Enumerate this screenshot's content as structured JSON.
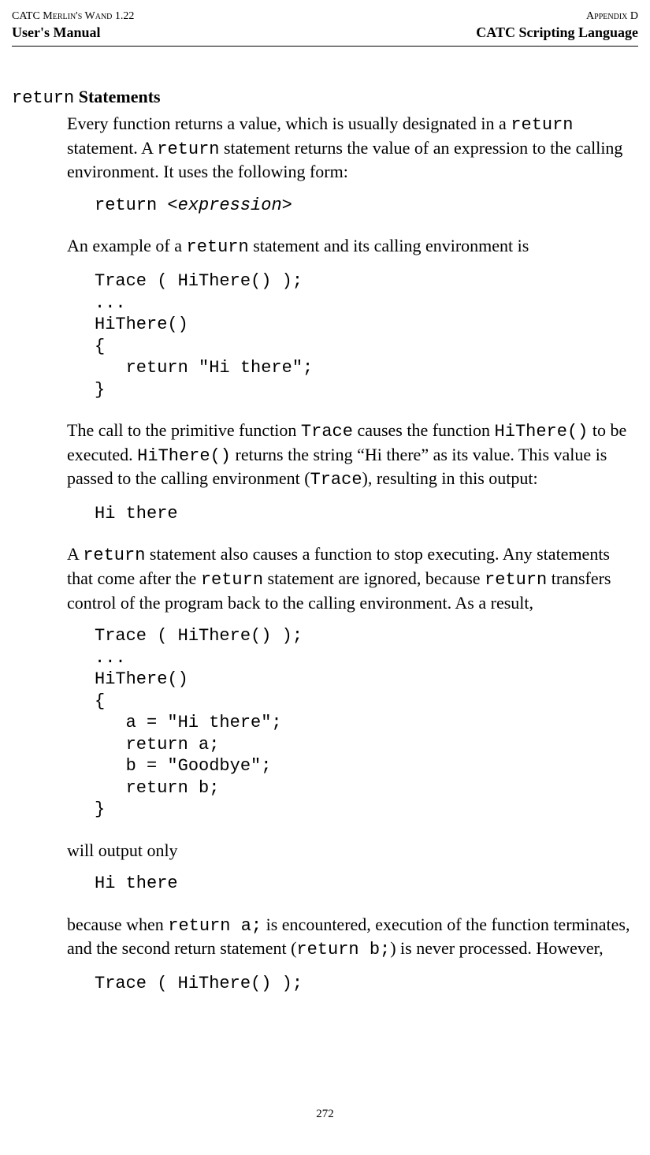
{
  "header": {
    "topLeft": "CATC Merlin's Wand 1.22",
    "topRight": "Appendix D",
    "bottomLeft": "User's Manual",
    "bottomRight": "CATC Scripting Language"
  },
  "section": {
    "titleCode": "return",
    "titleBold": " Statements"
  },
  "paragraphs": {
    "p1_part1": "Every function returns a value, which is usually designated in a ",
    "p1_code1": "return",
    "p1_part2": " statement. A ",
    "p1_code2": "return",
    "p1_part3": " statement returns the value of an expression to the calling environment. It uses the following form:",
    "p2_part1": "An example of a ",
    "p2_code1": "return",
    "p2_part2": " statement and its calling environment is",
    "p3_part1": "The call to the primitive function ",
    "p3_code1": "Trace",
    "p3_part2": " causes the function ",
    "p3_code2": "HiThere()",
    "p3_part3": " to be executed. ",
    "p3_code3": "HiThere()",
    "p3_part4": " returns the string “Hi there” as its value. This value is passed to the calling environment (",
    "p3_code4": "Trace",
    "p3_part5": "), resulting in this output:",
    "p4_part1": "A ",
    "p4_code1": "return",
    "p4_part2": " statement also causes a function to stop executing. Any statements that come after the ",
    "p4_code2": "return",
    "p4_part3": " statement are ignored, because ",
    "p4_code3": "return",
    "p4_part4": " transfers control of the program back to the calling environment. As a result,",
    "p5": "will output only",
    "p6_part1": "because when ",
    "p6_code1": "return a;",
    "p6_part2": " is encountered, execution of the function terminates, and the second return statement (",
    "p6_code2": "return b;",
    "p6_part3": ") is never processed. However,"
  },
  "codeBlocks": {
    "cb1_part1": "return <",
    "cb1_italic": "expression",
    "cb1_part2": ">",
    "cb2": "Trace ( HiThere() );\n...\nHiThere()\n{\n   return \"Hi there\";\n}",
    "cb3": "Hi there",
    "cb4": "Trace ( HiThere() );\n...\nHiThere()\n{\n   a = \"Hi there\";\n   return a;\n   b = \"Goodbye\";\n   return b;\n}",
    "cb5": "Hi there",
    "cb6": "Trace ( HiThere() );"
  },
  "pageNumber": "272"
}
